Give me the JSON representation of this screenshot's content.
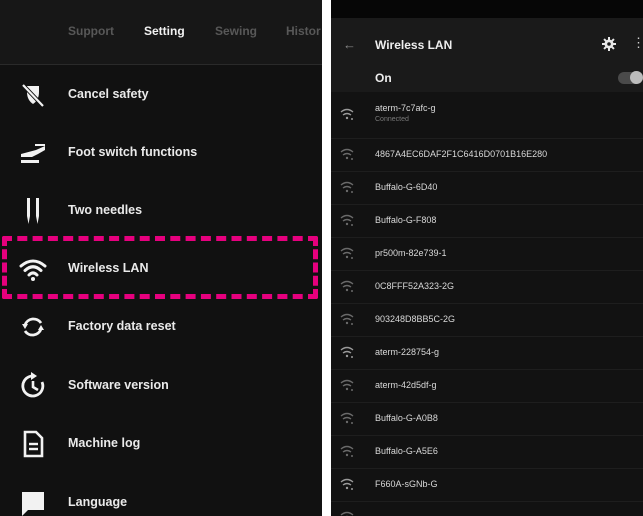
{
  "settings": {
    "tabs": [
      "Support",
      "Setting",
      "Sewing",
      "Histor"
    ],
    "active_tab": 1,
    "items": [
      {
        "label": "Cancel safety",
        "icon": "cancel-safety-icon"
      },
      {
        "label": "Foot switch functions",
        "icon": "foot-switch-icon"
      },
      {
        "label": "Two needles",
        "icon": "two-needles-icon"
      },
      {
        "label": "Wireless LAN",
        "icon": "wifi-icon"
      },
      {
        "label": "Factory data reset",
        "icon": "reset-icon"
      },
      {
        "label": "Software version",
        "icon": "software-version-icon"
      },
      {
        "label": "Machine log",
        "icon": "document-icon"
      },
      {
        "label": "Language",
        "icon": "chat-bubble-icon"
      }
    ],
    "highlighted_item": "Wireless LAN",
    "highlight_color": "#e6007e"
  },
  "wireless": {
    "back_icon": "arrow-left-icon",
    "title": "Wireless LAN",
    "settings_icon": "gear-icon",
    "more_icon": "more-vertical-icon",
    "toggle_label": "On",
    "toggle_on": true,
    "networks": [
      {
        "name": "aterm-7c7afc-g",
        "status": "Connected"
      },
      {
        "name": "4867A4EC6DAF2F1C6416D0701B16E280",
        "status": ""
      },
      {
        "name": "Buffalo-G-6D40",
        "status": ""
      },
      {
        "name": "Buffalo-G-F808",
        "status": ""
      },
      {
        "name": "pr500m-82e739-1",
        "status": ""
      },
      {
        "name": "0C8FFF52A323-2G",
        "status": ""
      },
      {
        "name": "903248D8BB5C-2G",
        "status": ""
      },
      {
        "name": "aterm-228754-g",
        "status": ""
      },
      {
        "name": "aterm-42d5df-g",
        "status": ""
      },
      {
        "name": "Buffalo-G-A0B8",
        "status": ""
      },
      {
        "name": "Buffalo-G-A5E6",
        "status": ""
      },
      {
        "name": "F660A-sGNb-G",
        "status": ""
      },
      {
        "name": "",
        "status": ""
      }
    ]
  }
}
